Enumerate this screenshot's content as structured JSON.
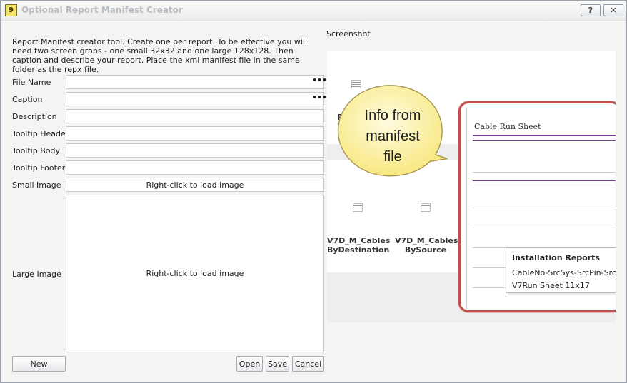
{
  "window": {
    "title": "Optional Report Manifest Creator",
    "icon_glyph": "9",
    "help_label": "?",
    "close_label": "✕"
  },
  "form": {
    "description": "Report Manifest creator tool. Create one per report. To be effective you will need two screen grabs - one small 32x32 and one large 128x128. Then caption and describe your report. Place the xml manifest file in the same folder as the repx file.",
    "fields": {
      "file_name": {
        "label": "File Name",
        "value": "",
        "browse": "•••"
      },
      "caption": {
        "label": "Caption",
        "value": "",
        "browse": "•••"
      },
      "description": {
        "label": "Description",
        "value": ""
      },
      "tooltip_header": {
        "label": "Tooltip Header",
        "value": ""
      },
      "tooltip_body": {
        "label": "Tooltip Body",
        "value": ""
      },
      "tooltip_footer": {
        "label": "Tooltip Footer",
        "value": ""
      }
    },
    "small_image": {
      "label": "Small Image",
      "hint": "Right-click to load image"
    },
    "large_image": {
      "label": "Large Image",
      "hint": "Right-click to load image"
    }
  },
  "buttons": {
    "new": "New",
    "open": "Open",
    "save": "Save",
    "cancel": "Cancel"
  },
  "screenshot": {
    "label": "Screenshot",
    "partial_item_line1": "R",
    "partial_item_line2": "11",
    "items": [
      {
        "line1": "V7D_M_Cables",
        "line2": "ByDestination"
      },
      {
        "line1": "V7D_M_Cables",
        "line2": "BySource"
      }
    ],
    "document_title": "Cable Run Sheet",
    "callout": "Info from manifest file",
    "callout_lines": [
      "Info from",
      "manifest",
      "file"
    ],
    "tooltip": {
      "header": "Installation Reports",
      "line1": "CableNo-SrcSys-SrcPin-SrcAlia",
      "line2": "V7Run Sheet 11x17"
    },
    "colors": {
      "frame": "#c0504d",
      "rule": "#7b3f94",
      "callout_fill": "#fdf4a8"
    }
  }
}
